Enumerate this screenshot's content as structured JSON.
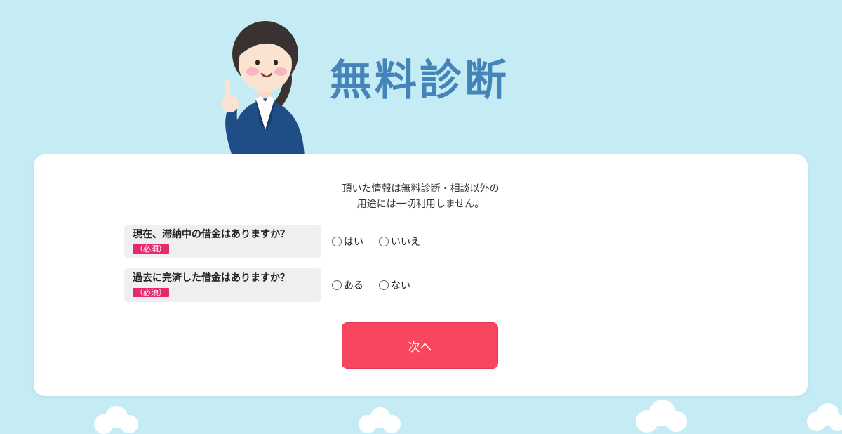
{
  "header": {
    "title": "無料診断"
  },
  "form": {
    "notice_line1": "頂いた情報は無料診断・相談以外の",
    "notice_line2": "用途には一切利用しません。",
    "questions": [
      {
        "label": "現在、滞納中の借金はありますか？",
        "required": "（必須）",
        "options": [
          "はい",
          "いいえ"
        ]
      },
      {
        "label": "過去に完済した借金はありますか？",
        "required": "（必須）",
        "options": [
          "ある",
          "ない"
        ]
      }
    ],
    "next_label": "次へ"
  },
  "colors": {
    "background": "#c5ecf4",
    "title": "#4584b8",
    "required_badge": "#e6286e",
    "next_button": "#f8465e"
  }
}
